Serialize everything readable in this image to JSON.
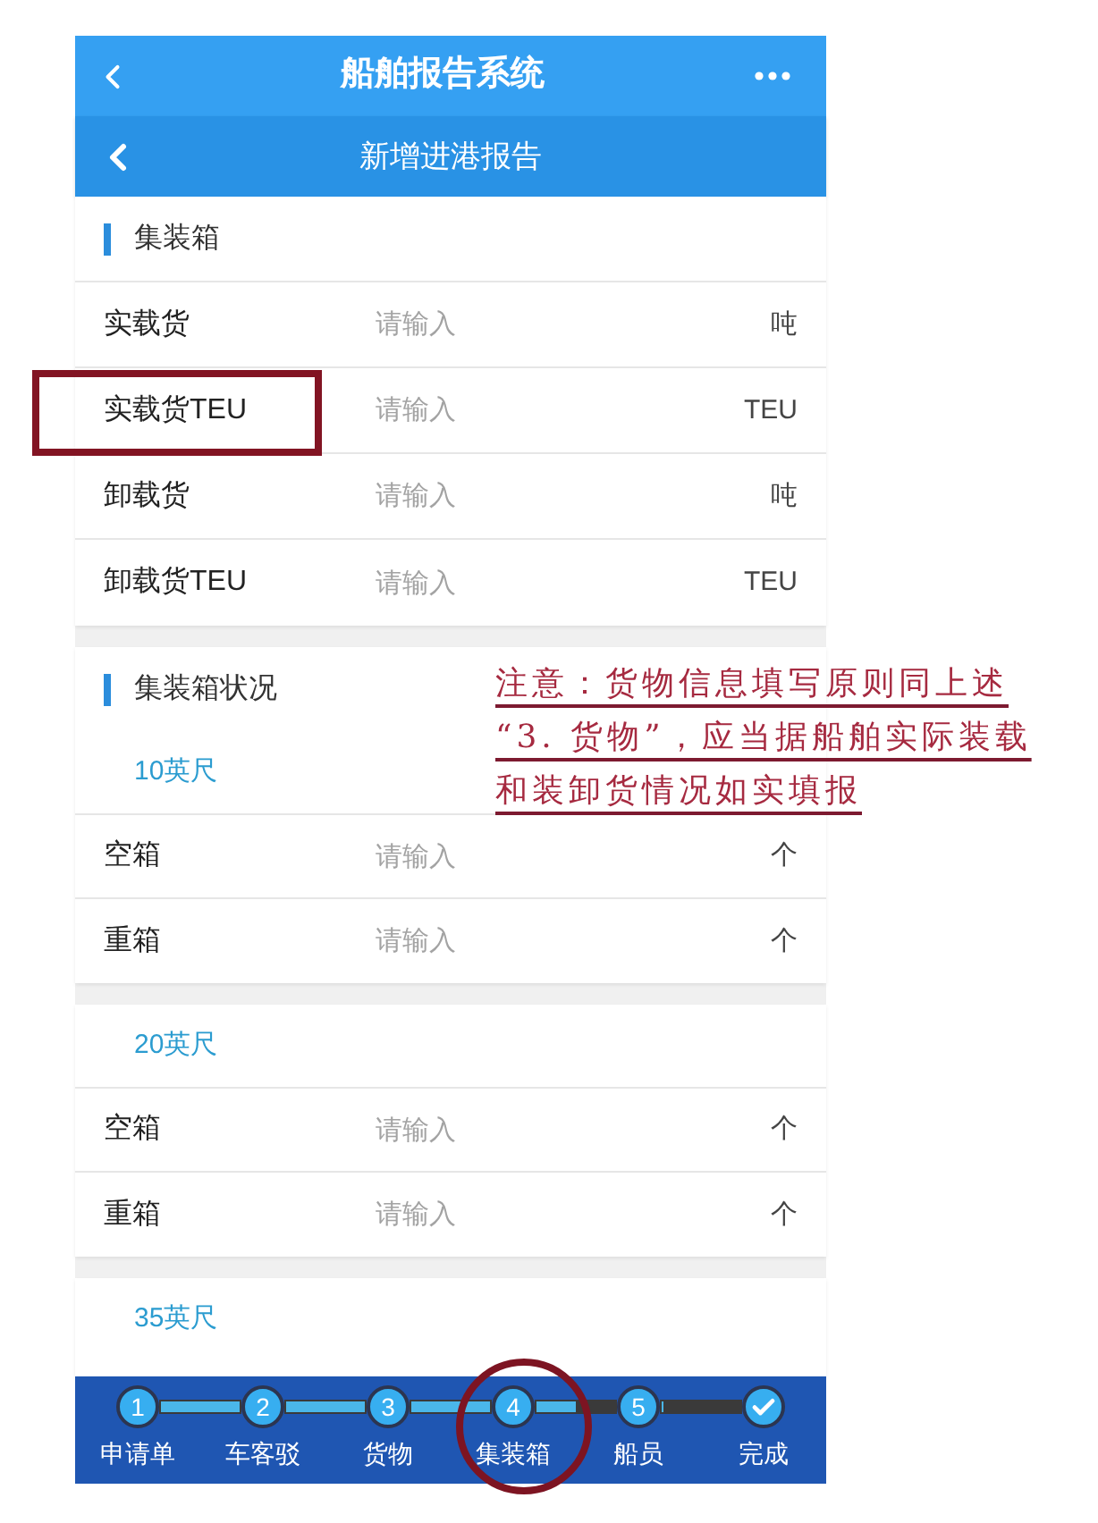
{
  "app_bar": {
    "title": "船舶报告系统"
  },
  "page_header": {
    "title": "新增进港报告"
  },
  "cargo_section": {
    "title": "集装箱",
    "rows": [
      {
        "label": "实载货",
        "placeholder": "请输入",
        "unit": "吨",
        "highlighted": false
      },
      {
        "label": "实载货TEU",
        "placeholder": "请输入",
        "unit": "TEU",
        "highlighted": true
      },
      {
        "label": "卸载货",
        "placeholder": "请输入",
        "unit": "吨",
        "highlighted": false
      },
      {
        "label": "卸载货TEU",
        "placeholder": "请输入",
        "unit": "TEU",
        "highlighted": false
      }
    ]
  },
  "status_section": {
    "title": "集装箱状况",
    "groups": [
      {
        "size": "10英尺",
        "rows": [
          {
            "label": "空箱",
            "placeholder": "请输入",
            "unit": "个",
            "highlighted": false
          },
          {
            "label": "重箱",
            "placeholder": "请输入",
            "unit": "个",
            "highlighted": false
          }
        ]
      },
      {
        "size": "20英尺",
        "rows": [
          {
            "label": "空箱",
            "placeholder": "请输入",
            "unit": "个",
            "highlighted": false
          },
          {
            "label": "重箱",
            "placeholder": "请输入",
            "unit": "个",
            "highlighted": false
          }
        ]
      },
      {
        "size": "35英尺"
      }
    ]
  },
  "annotation": {
    "lines": [
      "注意：货物信息填写原则同上述",
      "“3. 货物”，应当据船舶实际装载",
      "和装卸货情况如实填报"
    ]
  },
  "stepper": {
    "steps": [
      {
        "kind": "number",
        "number": "1",
        "label": "申请单",
        "circled": false
      },
      {
        "kind": "number",
        "number": "2",
        "label": "车客驳",
        "circled": false
      },
      {
        "kind": "number",
        "number": "3",
        "label": "货物",
        "circled": false
      },
      {
        "kind": "number",
        "number": "4",
        "label": "集装箱",
        "circled": true
      },
      {
        "kind": "number",
        "number": "5",
        "label": "船员",
        "circled": false
      },
      {
        "kind": "check",
        "label": "完成",
        "circled": false
      }
    ],
    "connectors": [
      {
        "level": 1
      },
      {
        "level": 1
      },
      {
        "level": 1
      },
      {
        "level": 0.5
      },
      {
        "level": 0
      }
    ]
  }
}
